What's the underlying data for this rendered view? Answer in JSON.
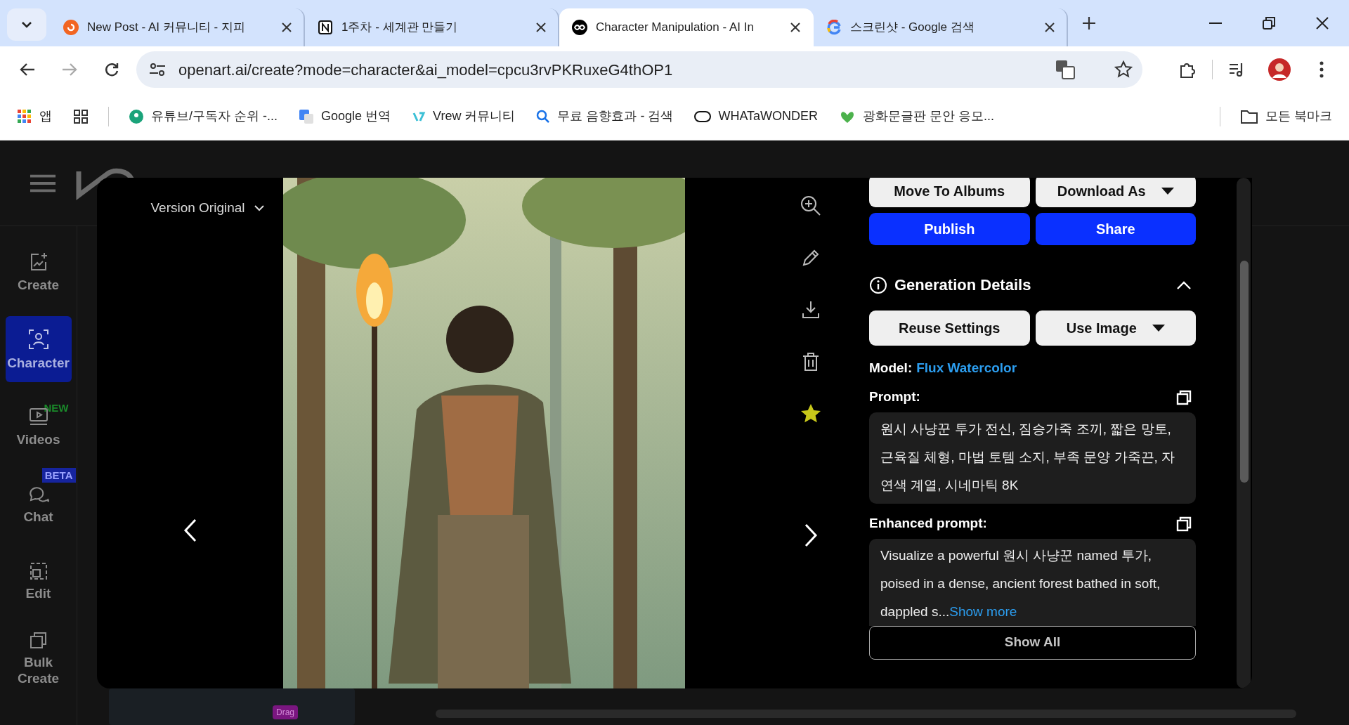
{
  "browser": {
    "tabs": [
      {
        "title": "New Post - AI 커뮤니티 - 지피",
        "selected": false
      },
      {
        "title": "1주차 - 세계관 만들기",
        "selected": false
      },
      {
        "title": "Character Manipulation - AI In",
        "selected": true
      },
      {
        "title": "스크린샷 - Google 검색",
        "selected": false
      }
    ],
    "url": "openart.ai/create?mode=character&ai_model=cpcu3rvPKRuxeG4thOP1",
    "bookmarks": [
      {
        "label": "앱"
      },
      {
        "label": "유튜브/구독자 순위 -..."
      },
      {
        "label": "Google 번역"
      },
      {
        "label": "Vrew 커뮤니티"
      },
      {
        "label": "무료 음향효과 - 검색"
      },
      {
        "label": "WHATaWONDER"
      },
      {
        "label": "광화문글판 문안 응모..."
      }
    ],
    "all_bookmarks": "모든 북마크"
  },
  "sidebar": {
    "items": [
      {
        "label": "Create",
        "selected": false
      },
      {
        "label": "Character",
        "selected": true
      },
      {
        "label": "Videos",
        "selected": false,
        "badge": "NEW"
      },
      {
        "label": "Chat",
        "selected": false,
        "badge": "BETA"
      },
      {
        "label": "Edit",
        "selected": false
      },
      {
        "label": "Bulk Create",
        "selected": false
      }
    ]
  },
  "background": {
    "drag_badge": "Drag"
  },
  "viewer": {
    "version": "Version Original",
    "favorite": true
  },
  "details": {
    "top_buttons": [
      {
        "label": "Move To Albums"
      },
      {
        "label": "Download As"
      },
      {
        "label": "Publish"
      },
      {
        "label": "Share"
      }
    ],
    "section_title": "Generation Details",
    "expanded": true,
    "buttons": [
      {
        "label": "Reuse Settings"
      },
      {
        "label": "Use Image"
      }
    ],
    "model_label": "Model:",
    "model": "Flux Watercolor",
    "prompt_label": "Prompt:",
    "prompt": "원시 사냥꾼 투가 전신, 짐승가죽 조끼, 짧은 망토, 근육질 체형, 마법 토템 소지, 부족 문양 가죽끈, 자연색 계열, 시네마틱 8K",
    "enhanced_label": "Enhanced prompt:",
    "enhanced_prompt": "Visualize a powerful 원시 사냥꾼 named 투가, poised in a dense, ancient forest bathed in soft, dappled s...",
    "show_more": "Show more",
    "show_all": "Show All"
  }
}
